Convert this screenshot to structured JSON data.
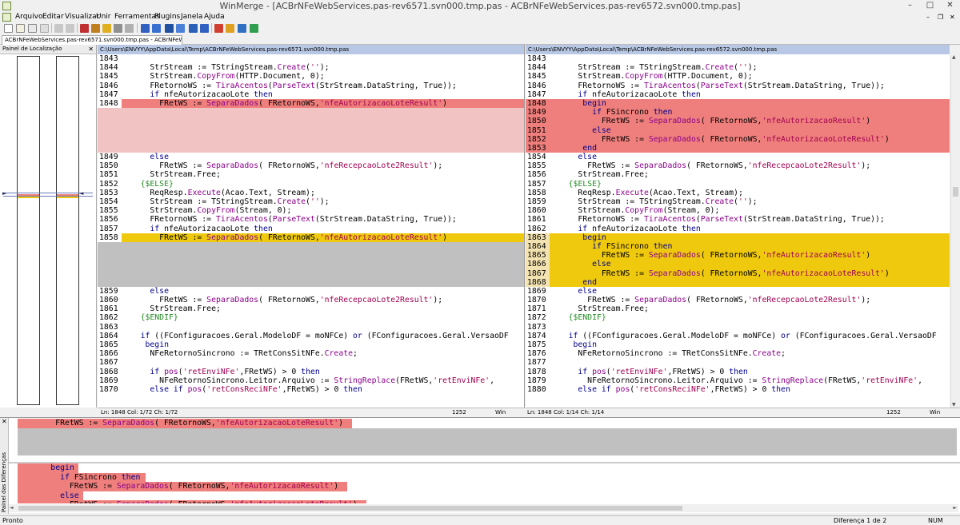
{
  "window": {
    "title": "WinMerge - [ACBrNFeWebServices.pas-rev6571.svn000.tmp.pas - ACBrNFeWebServices.pas-rev6572.svn000.tmp.pas]",
    "minimize": "–",
    "maximize": "□",
    "close": "✕"
  },
  "menu": {
    "items": [
      "Arquivo",
      "Editar",
      "Visualizar",
      "Unir",
      "Ferramentas",
      "Plugins",
      "Janela",
      "Ajuda"
    ],
    "min": "–",
    "restore": "❐",
    "close": "✕"
  },
  "tab": {
    "label": "ACBrNFeWebServices.pas-rev6571.svn000.tmp.pas - ACBrNFeWebSer..."
  },
  "location_pane": {
    "title": "Painel de Localização",
    "close": "✕"
  },
  "left_pane": {
    "path": "C:\\Users\\ENVYY\\AppData\\Local\\Temp\\ACBrNFeWebServices.pas-rev6571.svn000.tmp.pas",
    "lines": [
      {
        "n": "1843",
        "c": "",
        "hl": ""
      },
      {
        "n": "1844",
        "c": "      StrStream := TStringStream.Create('');",
        "hl": ""
      },
      {
        "n": "1845",
        "c": "      StrStream.CopyFrom(HTTP.Document, 0);",
        "hl": ""
      },
      {
        "n": "1846",
        "c": "      FRetornoWS := TiraAcentos(ParseText(StrStream.DataString, True));",
        "hl": ""
      },
      {
        "n": "1847",
        "c": "      if nfeAutorizacaoLote then",
        "hl": ""
      },
      {
        "n": "1848",
        "c": "        FRetWS := SeparaDados( FRetornoWS,'nfeAutorizacaoLoteResult')",
        "hl": "r"
      },
      {
        "n": "",
        "c": "",
        "hl": "rl"
      },
      {
        "n": "",
        "c": "",
        "hl": "rl"
      },
      {
        "n": "",
        "c": "",
        "hl": "rl"
      },
      {
        "n": "",
        "c": "",
        "hl": "rl"
      },
      {
        "n": "",
        "c": "",
        "hl": "rl"
      },
      {
        "n": "1849",
        "c": "      else",
        "hl": ""
      },
      {
        "n": "1850",
        "c": "        FRetWS := SeparaDados( FRetornoWS,'nfeRecepcaoLote2Result');",
        "hl": ""
      },
      {
        "n": "1851",
        "c": "      StrStream.Free;",
        "hl": ""
      },
      {
        "n": "1852",
        "c": "    {$ELSE}",
        "hl": ""
      },
      {
        "n": "1853",
        "c": "      ReqResp.Execute(Acao.Text, Stream);",
        "hl": ""
      },
      {
        "n": "1854",
        "c": "      StrStream := TStringStream.Create('');",
        "hl": ""
      },
      {
        "n": "1855",
        "c": "      StrStream.CopyFrom(Stream, 0);",
        "hl": ""
      },
      {
        "n": "1856",
        "c": "      FRetornoWS := TiraAcentos(ParseText(StrStream.DataString, True));",
        "hl": ""
      },
      {
        "n": "1857",
        "c": "      if nfeAutorizacaoLote then",
        "hl": ""
      },
      {
        "n": "1858",
        "c": "        FRetWS := SeparaDados( FRetornoWS,'nfeAutorizacaoLoteResult')",
        "hl": "y"
      },
      {
        "n": "",
        "c": "",
        "hl": "g"
      },
      {
        "n": "",
        "c": "",
        "hl": "g"
      },
      {
        "n": "",
        "c": "",
        "hl": "g"
      },
      {
        "n": "",
        "c": "",
        "hl": "g"
      },
      {
        "n": "",
        "c": "",
        "hl": "g"
      },
      {
        "n": "1859",
        "c": "      else",
        "hl": ""
      },
      {
        "n": "1860",
        "c": "        FRetWS := SeparaDados( FRetornoWS,'nfeRecepcaoLote2Result');",
        "hl": ""
      },
      {
        "n": "1861",
        "c": "      StrStream.Free;",
        "hl": ""
      },
      {
        "n": "1862",
        "c": "    {$ENDIF}",
        "hl": ""
      },
      {
        "n": "1863",
        "c": "",
        "hl": ""
      },
      {
        "n": "1864",
        "c": "    if ((FConfiguracoes.Geral.ModeloDF = moNFCe) or (FConfiguracoes.Geral.VersaoDF",
        "hl": ""
      },
      {
        "n": "1865",
        "c": "     begin",
        "hl": ""
      },
      {
        "n": "1866",
        "c": "      NFeRetornoSincrono := TRetConsSitNFe.Create;",
        "hl": ""
      },
      {
        "n": "1867",
        "c": "",
        "hl": ""
      },
      {
        "n": "1868",
        "c": "      if pos('retEnviNFe',FRetWS) > 0 then",
        "hl": ""
      },
      {
        "n": "1869",
        "c": "        NFeRetornoSincrono.Leitor.Arquivo := StringReplace(FRetWS,'retEnviNFe',",
        "hl": ""
      },
      {
        "n": "1870",
        "c": "      else if pos('retConsReciNFe',FRetWS) > 0 then",
        "hl": ""
      }
    ]
  },
  "right_pane": {
    "path": "C:\\Users\\ENVYY\\AppData\\Local\\Temp\\ACBrNFeWebServices.pas-rev6572.svn000.tmp.pas",
    "lines": [
      {
        "n": "1843",
        "c": "",
        "hl": ""
      },
      {
        "n": "1844",
        "c": "      StrStream := TStringStream.Create('');",
        "hl": ""
      },
      {
        "n": "1845",
        "c": "      StrStream.CopyFrom(HTTP.Document, 0);",
        "hl": ""
      },
      {
        "n": "1846",
        "c": "      FRetornoWS := TiraAcentos(ParseText(StrStream.DataString, True));",
        "hl": ""
      },
      {
        "n": "1847",
        "c": "      if nfeAutorizacaoLote then",
        "hl": ""
      },
      {
        "n": "1848",
        "c": "       begin",
        "hl": "r"
      },
      {
        "n": "1849",
        "c": "         if FSincrono then",
        "hl": "r"
      },
      {
        "n": "1850",
        "c": "           FRetWS := SeparaDados( FRetornoWS,'nfeAutorizacaoResult')",
        "hl": "r"
      },
      {
        "n": "1851",
        "c": "         else",
        "hl": "r"
      },
      {
        "n": "1852",
        "c": "           FRetWS := SeparaDados( FRetornoWS,'nfeAutorizacaoLoteResult')",
        "hl": "r"
      },
      {
        "n": "1853",
        "c": "       end",
        "hl": "r"
      },
      {
        "n": "1854",
        "c": "      else",
        "hl": ""
      },
      {
        "n": "1855",
        "c": "        FRetWS := SeparaDados( FRetornoWS,'nfeRecepcaoLote2Result');",
        "hl": ""
      },
      {
        "n": "1856",
        "c": "      StrStream.Free;",
        "hl": ""
      },
      {
        "n": "1857",
        "c": "    {$ELSE}",
        "hl": ""
      },
      {
        "n": "1858",
        "c": "      ReqResp.Execute(Acao.Text, Stream);",
        "hl": ""
      },
      {
        "n": "1859",
        "c": "      StrStream := TStringStream.Create('');",
        "hl": ""
      },
      {
        "n": "1860",
        "c": "      StrStream.CopyFrom(Stream, 0);",
        "hl": ""
      },
      {
        "n": "1861",
        "c": "      FRetornoWS := TiraAcentos(ParseText(StrStream.DataString, True));",
        "hl": ""
      },
      {
        "n": "1862",
        "c": "      if nfeAutorizacaoLote then",
        "hl": ""
      },
      {
        "n": "1863",
        "c": "       begin",
        "hl": "y"
      },
      {
        "n": "1864",
        "c": "         if FSincrono then",
        "hl": "y"
      },
      {
        "n": "1865",
        "c": "           FRetWS := SeparaDados( FRetornoWS,'nfeAutorizacaoResult')",
        "hl": "y"
      },
      {
        "n": "1866",
        "c": "         else",
        "hl": "y"
      },
      {
        "n": "1867",
        "c": "           FRetWS := SeparaDados( FRetornoWS,'nfeAutorizacaoLoteResult')",
        "hl": "y"
      },
      {
        "n": "1868",
        "c": "       end",
        "hl": "y"
      },
      {
        "n": "1869",
        "c": "      else",
        "hl": ""
      },
      {
        "n": "1870",
        "c": "        FRetWS := SeparaDados( FRetornoWS,'nfeRecepcaoLote2Result');",
        "hl": ""
      },
      {
        "n": "1871",
        "c": "      StrStream.Free;",
        "hl": ""
      },
      {
        "n": "1872",
        "c": "    {$ENDIF}",
        "hl": ""
      },
      {
        "n": "1873",
        "c": "",
        "hl": ""
      },
      {
        "n": "1874",
        "c": "    if ((FConfiguracoes.Geral.ModeloDF = moNFCe) or (FConfiguracoes.Geral.VersaoDF",
        "hl": ""
      },
      {
        "n": "1875",
        "c": "     begin",
        "hl": ""
      },
      {
        "n": "1876",
        "c": "      NFeRetornoSincrono := TRetConsSitNFe.Create;",
        "hl": ""
      },
      {
        "n": "1877",
        "c": "",
        "hl": ""
      },
      {
        "n": "1878",
        "c": "      if pos('retEnviNFe',FRetWS) > 0 then",
        "hl": ""
      },
      {
        "n": "1879",
        "c": "        NFeRetornoSincrono.Leitor.Arquivo := StringReplace(FRetWS,'retEnviNFe',",
        "hl": ""
      },
      {
        "n": "1880",
        "c": "      else if pos('retConsReciNFe',FRetWS) > 0 then",
        "hl": ""
      }
    ]
  },
  "left_status": {
    "pos": "Ln: 1848  Col: 1/72  Ch: 1/72",
    "codepage": "1252",
    "eol": "Win"
  },
  "right_status": {
    "pos": "Ln: 1848  Col: 1/14  Ch: 1/14",
    "codepage": "1252",
    "eol": "Win"
  },
  "diff_pane": {
    "title": "Painel das Diferenças",
    "close": "✕",
    "top_lines": [
      {
        "c": "        FRetWS := SeparaDados( FRetornoWS,'nfeAutorizacaoLoteResult')",
        "hl": "r"
      },
      {
        "c": "",
        "hl": "g"
      },
      {
        "c": "",
        "hl": "g"
      },
      {
        "c": "",
        "hl": "g"
      }
    ],
    "bottom_lines": [
      {
        "c": "       begin",
        "hl": "r"
      },
      {
        "c": "         if FSincrono then",
        "hl": "r"
      },
      {
        "c": "           FRetWS := SeparaDados( FRetornoWS,'nfeAutorizacaoResult')",
        "hl": "r"
      },
      {
        "c": "         else",
        "hl": "r"
      },
      {
        "c": "           FRetWS := SeparaDados( FRetornoWS,'nfeAutorizacaoLoteResult')",
        "hl": "r"
      }
    ]
  },
  "statusbar": {
    "left": "Pronto",
    "diff": "Diferença 1 de 2",
    "num": "NUM"
  },
  "colors": {
    "diff_red": "#ef7f7c",
    "diff_red_light": "#f1c3c3",
    "diff_gray": "#c0c0c0",
    "diff_yellow": "#efc90e",
    "diff_yellow_light": "#f3e3b0",
    "path_bar": "#b8c8e4"
  },
  "toolbar_icons": [
    "new-icon",
    "open-icon",
    "save-icon",
    "save-all-icon",
    "undo-icon",
    "redo-icon",
    "prev-diff-icon",
    "next-diff-icon",
    "first-diff-icon",
    "last-diff-icon",
    "current-diff-icon",
    "copy-right-icon",
    "copy-left-icon",
    "copy-right-advance-icon",
    "copy-left-advance-icon",
    "all-right-icon",
    "all-left-icon",
    "options-icon",
    "refresh-icon",
    "wrap-icon"
  ]
}
